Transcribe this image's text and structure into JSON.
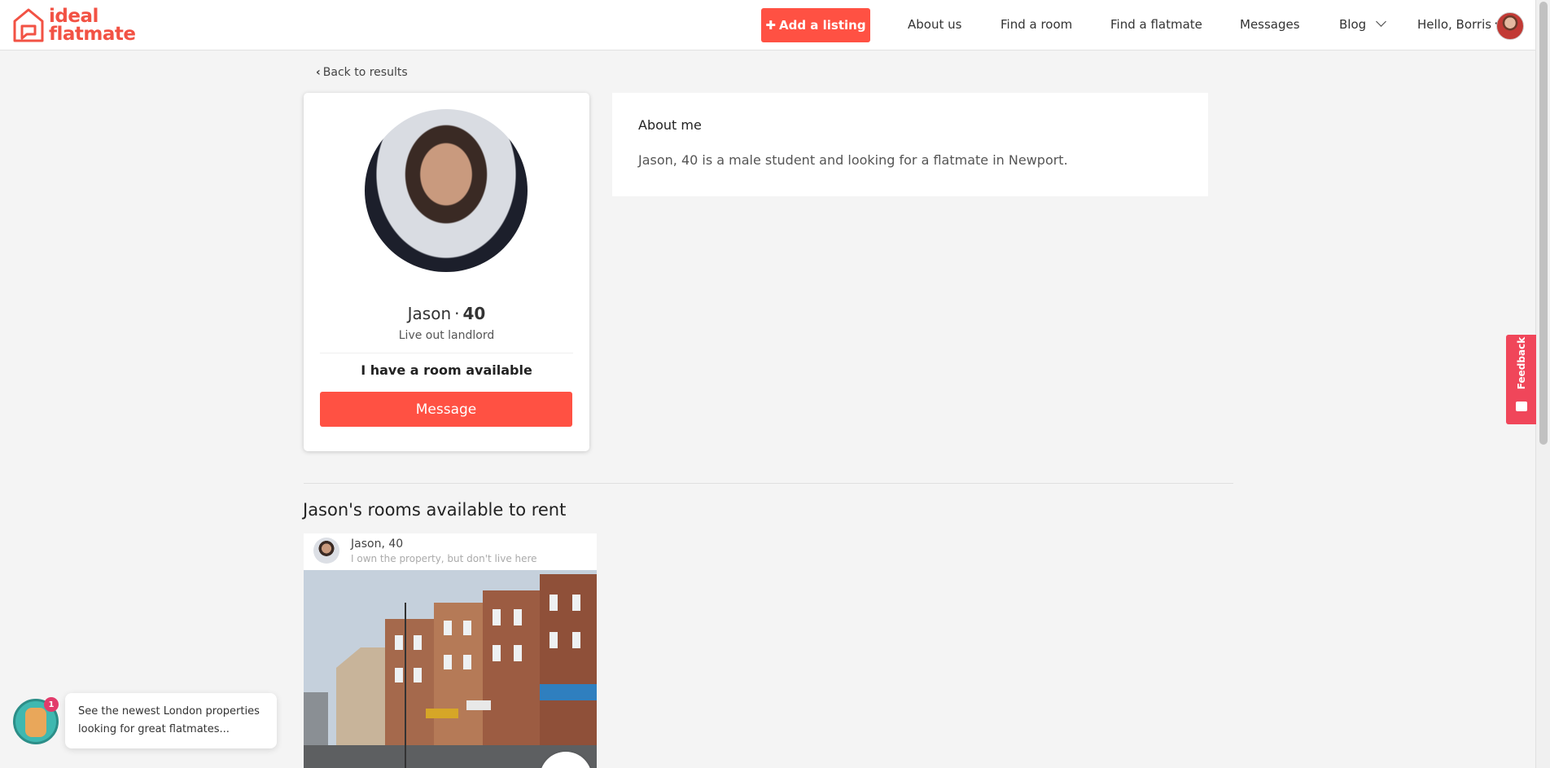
{
  "header": {
    "logo": {
      "line1": "ideal",
      "line2": "flatmate"
    },
    "add_listing_label": "Add a listing",
    "nav": [
      {
        "label": "About us"
      },
      {
        "label": "Find a room"
      },
      {
        "label": "Find a flatmate"
      },
      {
        "label": "Messages"
      },
      {
        "label": "Blog"
      }
    ],
    "user_greeting": "Hello, Borris"
  },
  "back_link": "Back to results",
  "profile": {
    "name": "Jason",
    "dot": "·",
    "age": "40",
    "role": "Live out landlord",
    "room_status": "I have a room available",
    "message_label": "Message"
  },
  "about": {
    "title": "About me",
    "text": "Jason, 40 is a male student and looking for a flatmate in Newport."
  },
  "rooms": {
    "heading": "Jason's rooms available to rent",
    "items": [
      {
        "owner": "Jason, 40",
        "owner_desc": "I own the property, but don't live here"
      }
    ]
  },
  "feedback_label": "Feedback",
  "chat": {
    "badge": "1",
    "message": "See the newest London properties looking for great flatmates..."
  },
  "colors": {
    "accent": "#ff5143",
    "feedback": "#f0465a"
  }
}
